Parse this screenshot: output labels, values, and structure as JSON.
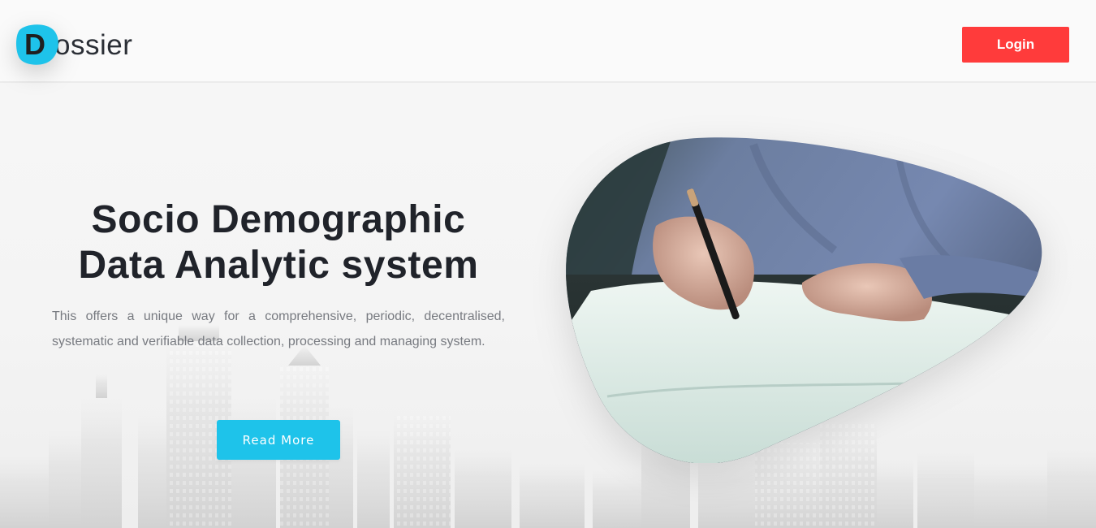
{
  "header": {
    "logo_letter": "D",
    "logo_text": "ossier",
    "login_label": "Login"
  },
  "hero": {
    "title_line1": "Socio Demographic",
    "title_line2": "Data Analytic system",
    "description": "This offers a unique way for a comprehensive, periodic, decentralised, systematic and verifiable data collection, processing and managing system.",
    "cta_label": "Read More"
  },
  "colors": {
    "brand_blue": "#1ec3ea",
    "login_red": "#ff3b3b",
    "title_text": "#20232a",
    "body_text": "#777a80"
  },
  "icons": {
    "logo": "dossier-logo-icon"
  }
}
